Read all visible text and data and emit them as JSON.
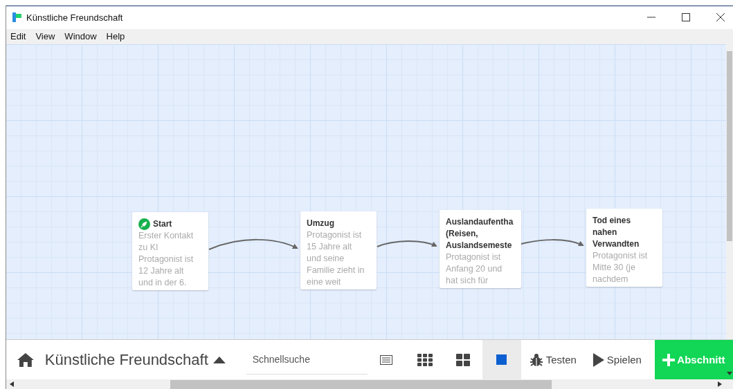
{
  "window": {
    "title": "Künstliche Freundschaft"
  },
  "menu": [
    "Edit",
    "View",
    "Window",
    "Help"
  ],
  "passages": [
    {
      "kind": "start",
      "title": "Start",
      "excerpt": "Erster Kontakt zu KI Protagonist ist 12 Jahre alt und in der 6."
    },
    {
      "kind": "normal",
      "title": "Umzug",
      "excerpt": "Protagonist ist 15 Jahre alt und seine Familie zieht in eine weit"
    },
    {
      "kind": "normal",
      "title": "Auslandaufentha (Reisen, Auslandsemeste",
      "excerpt": "Protagonist ist Anfang 20 und hat sich für"
    },
    {
      "kind": "normal",
      "title": "Tod eines nahen Verwandten",
      "excerpt": "Protagonist ist Mitte 30 (je nachdem"
    }
  ],
  "toolbar": {
    "story_title": "Künstliche Freundschaft",
    "search": {
      "placeholder": "Schnellsuche"
    },
    "zoom_buttons": [
      {
        "kind": "list",
        "selected": false
      },
      {
        "kind": "small",
        "selected": false
      },
      {
        "kind": "medium",
        "selected": false
      },
      {
        "kind": "large",
        "selected": true
      }
    ],
    "test_button": "Testen",
    "play_button": "Spielen",
    "add_button": "Abschnitt"
  }
}
